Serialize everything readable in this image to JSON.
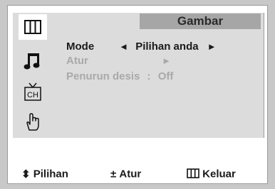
{
  "menu": {
    "title": "Gambar",
    "rows": {
      "mode": {
        "label": "Mode",
        "left_arrow": "◄",
        "value": "Pilihan anda",
        "right_arrow": "►"
      },
      "atur": {
        "label": "Atur",
        "right_arrow": "►"
      },
      "noise": {
        "label": "Penurun desis",
        "separator": ":",
        "value": "Off"
      }
    }
  },
  "sidebar": {
    "icons": [
      "picture-icon",
      "sound-icon",
      "channel-icon",
      "setup-icon"
    ],
    "channel_icon_text": "CH"
  },
  "footer": {
    "move": {
      "glyph": "⬍",
      "label": "Pilihan"
    },
    "adjust": {
      "glyph": "±",
      "label": "Atur"
    },
    "exit": {
      "label": "Keluar"
    }
  },
  "colors": {
    "background": "#c8c8c8",
    "panel": "#dcdcdc",
    "title_tab": "#a6a6a6",
    "text": "#1a1a1a",
    "disabled_text": "#a9a9a9"
  }
}
